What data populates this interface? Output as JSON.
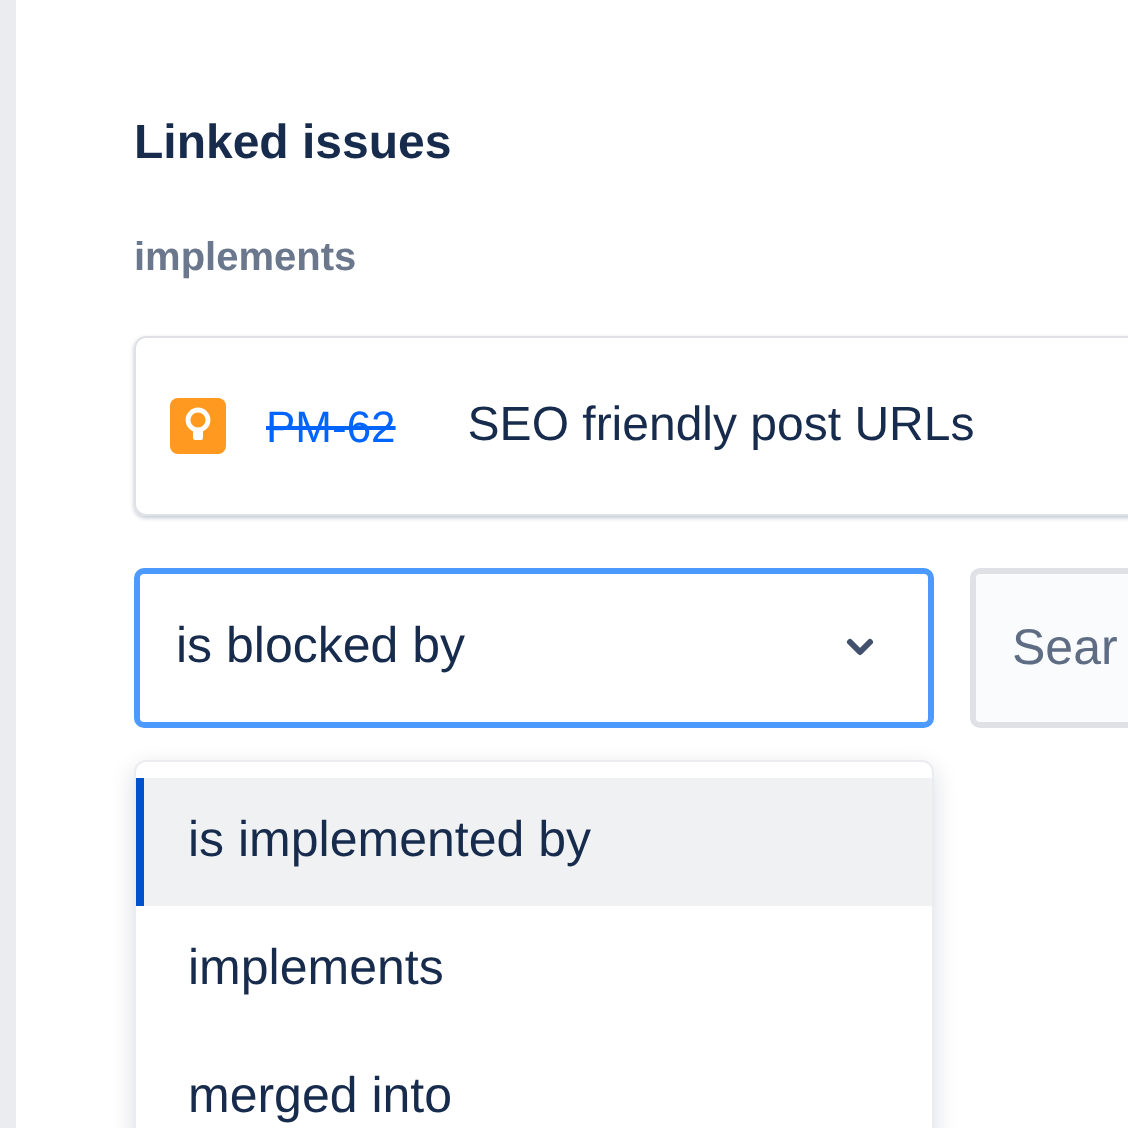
{
  "heading": "Linked issues",
  "groups": [
    {
      "label": "implements",
      "issues": [
        {
          "key": "PM-62",
          "resolved": true,
          "summary": "SEO friendly post URLs"
        }
      ]
    }
  ],
  "link_type_select": {
    "value": "is blocked by",
    "focused": true
  },
  "search": {
    "placeholder": "Sear"
  },
  "dropdown": {
    "options": [
      {
        "label": "is implemented by",
        "selected": true
      },
      {
        "label": "implements",
        "selected": false
      },
      {
        "label": "merged into",
        "selected": false
      }
    ]
  }
}
